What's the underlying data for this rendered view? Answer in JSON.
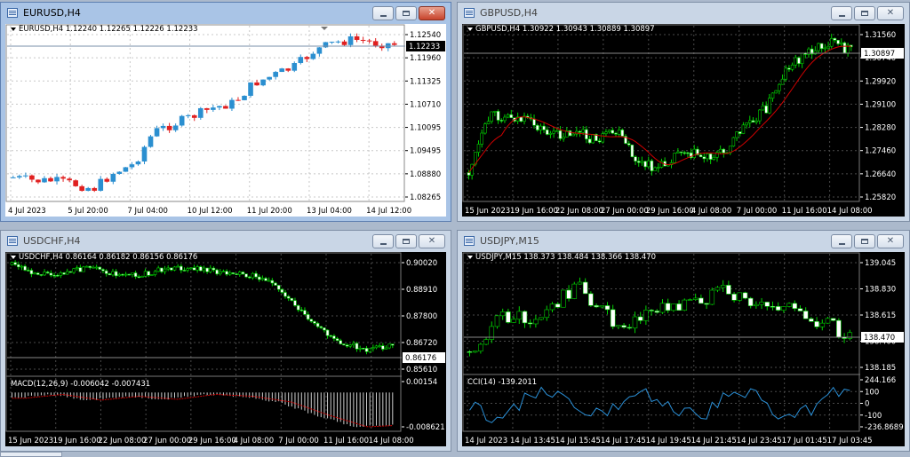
{
  "windows": [
    {
      "title": "EURUSD,H4",
      "active": true,
      "header": "EURUSD,H4  1.12240 1.12265 1.12226 1.12233",
      "price_label": "1.12233",
      "y_ticks": [
        "1.12540",
        "1.11960",
        "1.11325",
        "1.10710",
        "1.10095",
        "1.09495",
        "1.08880",
        "1.08265"
      ],
      "x_ticks": [
        "4 Jul 2023",
        "5 Jul 20:00",
        "7 Jul 04:00",
        "10 Jul 12:00",
        "11 Jul 20:00",
        "13 Jul 04:00",
        "14 Jul 12:00"
      ]
    },
    {
      "title": "GBPUSD,H4",
      "active": false,
      "header": "GBPUSD,H4  1.30922 1.30943 1.30889 1.30897",
      "price_label": "1.30897",
      "y_ticks": [
        "1.31560",
        "1.30740",
        "1.29920",
        "1.29100",
        "1.28280",
        "1.27460",
        "1.26640",
        "1.25820"
      ],
      "x_ticks": [
        "15 Jun 2023",
        "19 Jun 16:00",
        "22 Jun 08:00",
        "27 Jun 00:00",
        "29 Jun 16:00",
        "4 Jul 08:00",
        "7 Jul 00:00",
        "11 Jul 16:00",
        "14 Jul 08:00"
      ]
    },
    {
      "title": "USDCHF,H4",
      "active": false,
      "header": "USDCHF,H4  0.86164 0.86182 0.86156 0.86176",
      "price_label": "0.86176",
      "y_ticks": [
        "0.90020",
        "0.88910",
        "0.87800",
        "0.86720",
        "0.85610"
      ],
      "sub_header": "MACD(12,26,9) -0.006042 -0.007431",
      "sub_y_ticks": [
        "0.00154",
        "-0.008621"
      ],
      "x_ticks": [
        "15 Jun 2023",
        "19 Jun 16:00",
        "22 Jun 08:00",
        "27 Jun 00:00",
        "29 Jun 16:00",
        "4 Jul 08:00",
        "7 Jul 00:00",
        "11 Jul 16:00",
        "14 Jul 08:00"
      ]
    },
    {
      "title": "USDJPY,M15",
      "active": false,
      "header": "USDJPY,M15  138.373 138.484 138.366 138.470",
      "price_label": "138.470",
      "y_ticks": [
        "139.045",
        "138.830",
        "138.615",
        "138.400",
        "138.185"
      ],
      "sub_header": "CCI(14) -139.2011",
      "sub_y_ticks": [
        "244.166",
        "100",
        "0",
        "-100",
        "-236.8689"
      ],
      "x_ticks": [
        "14 Jul 2023",
        "14 Jul 13:45",
        "14 Jul 15:45",
        "14 Jul 17:45",
        "14 Jul 19:45",
        "14 Jul 21:45",
        "14 Jul 23:45",
        "17 Jul 01:45",
        "17 Jul 03:45"
      ]
    }
  ]
}
